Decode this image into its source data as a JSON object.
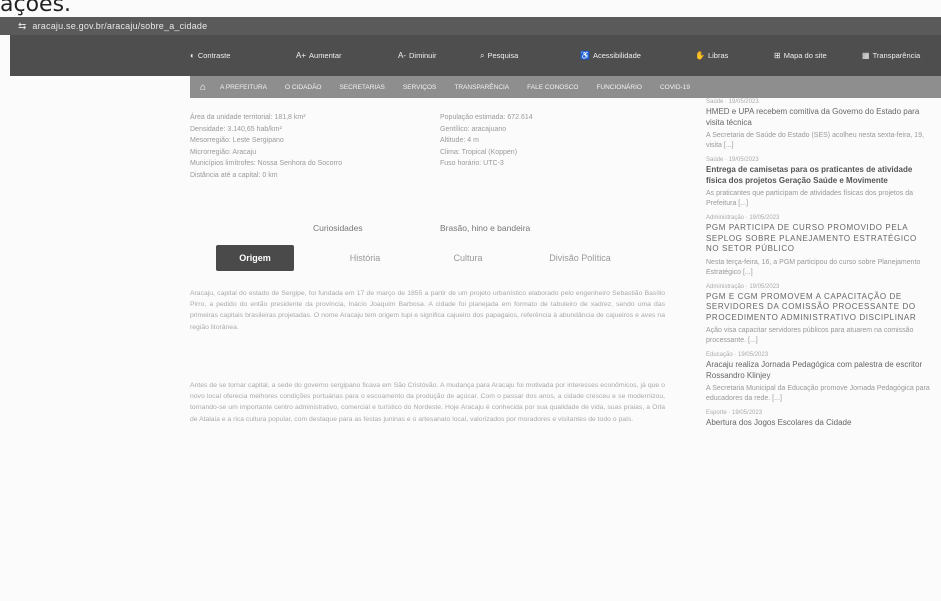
{
  "cutoff_text": "ações.",
  "browser": {
    "url": "aracaju.se.gov.br/aracaju/sobre_a_cidade"
  },
  "topnav": [
    {
      "label": "Contraste",
      "icon": "contrast-icon"
    },
    {
      "label": "Aumentar",
      "icon": "zoom-in-icon"
    },
    {
      "label": "Diminuir",
      "icon": "zoom-out-icon"
    },
    {
      "label": "Pesquisa",
      "icon": "search-icon"
    },
    {
      "label": "Acessibilidade",
      "icon": "accessibility-icon"
    },
    {
      "label": "Libras",
      "icon": "hands-icon"
    },
    {
      "label": "Mapa do site",
      "icon": "sitemap-icon"
    },
    {
      "label": "Transparência",
      "icon": "transparency-icon"
    }
  ],
  "subnav": [
    "A PREFEITURA",
    "O CIDADÃO",
    "SECRETARIAS",
    "SERVIÇOS",
    "TRANSPARÊNCIA",
    "FALE CONOSCO",
    "FUNCIONÁRIO",
    "COVID-19"
  ],
  "info_left": [
    "Área da unidade territorial: 181,8 km²",
    "Densidade: 3.140,65 hab/km²",
    "Mesorregião: Leste Sergipano",
    "Microrregião: Aracaju",
    "Municípios limítrofes: Nossa Senhora do Socorro",
    "Distância até a capital: 0 km"
  ],
  "info_right": [
    "População estimada: 672.614",
    "Gentílico: aracajuano",
    "Altitude: 4 m",
    "Clima: Tropical (Koppen)",
    "Fuso horário: UTC-3"
  ],
  "tabs_top": [
    "Curiosidades",
    "Brasão, hino e bandeira"
  ],
  "tabs": [
    "Origem",
    "História",
    "Cultura",
    "Divisão Política"
  ],
  "paragraphs": [
    "Aracaju, capital do estado de Sergipe, foi fundada em 17 de março de 1855 a partir de um projeto urbanístico elaborado pelo engenheiro Sebastião Basílio Pirro, a pedido do então presidente da província, Inácio Joaquim Barbosa. A cidade foi planejada em formato de tabuleiro de xadrez, sendo uma das primeiras capitais brasileiras projetadas. O nome Aracaju tem origem tupi e significa cajueiro dos papagaios, referência à abundância de cajueiros e aves na região litorânea.",
    "Antes de se tornar capital, a sede do governo sergipano ficava em São Cristóvão. A mudança para Aracaju foi motivada por interesses econômicos, já que o novo local oferecia melhores condições portuárias para o escoamento da produção de açúcar. Com o passar dos anos, a cidade cresceu e se modernizou, tornando-se um importante centro administrativo, comercial e turístico do Nordeste. Hoje Aracaju é conhecida por sua qualidade de vida, suas praias, a Orla de Atalaia e a rica cultura popular, com destaque para as festas juninas e o artesanato local, valorizados por moradores e visitantes de todo o país."
  ],
  "sidebar_news": [
    {
      "meta": "Saúde · 19/05/2023",
      "title": "HMED e UPA recebem comitiva da Governo do Estado para visita técnica",
      "title_style": "normal",
      "desc": "A Secretaria de Saúde do Estado (SES) acolheu nesta sexta-feira, 19, visita [...]"
    },
    {
      "meta": "Saúde · 19/05/2023",
      "title": "Entrega de camisetas para os praticantes de atividade física dos projetos Geração Saúde e Movimente",
      "title_style": "bold",
      "desc": "As praticantes que participam de atividades físicas dos projetos da Prefeitura [...]"
    },
    {
      "meta": "Administração · 19/05/2023",
      "title": "PGM participa de curso promovido pela SEPLOG sobre planejamento estratégico no setor público",
      "title_style": "caps",
      "desc": "Nesta terça-feira, 16, a PGM participou do curso sobre Planejamento Estratégico [...]"
    },
    {
      "meta": "Administração · 19/05/2023",
      "title": "PGM e CGM promovem a capacitação de servidores da Comissão Processante do Procedimento Administrativo Disciplinar",
      "title_style": "caps",
      "desc": "Ação visa capacitar servidores públicos para atuarem na comissão processante. [...]"
    },
    {
      "meta": "Educação · 19/05/2023",
      "title": "Aracaju realiza Jornada Pedagógica com palestra de escritor Rossandro Klinjey",
      "title_style": "normal",
      "desc": "A Secretaria Municipal da Educação promove Jornada Pedagógica para educadores da rede. [...]"
    },
    {
      "meta": "Esporte · 19/05/2023",
      "title": "Abertura dos Jogos Escolares da Cidade",
      "title_style": "normal",
      "desc": ""
    }
  ]
}
